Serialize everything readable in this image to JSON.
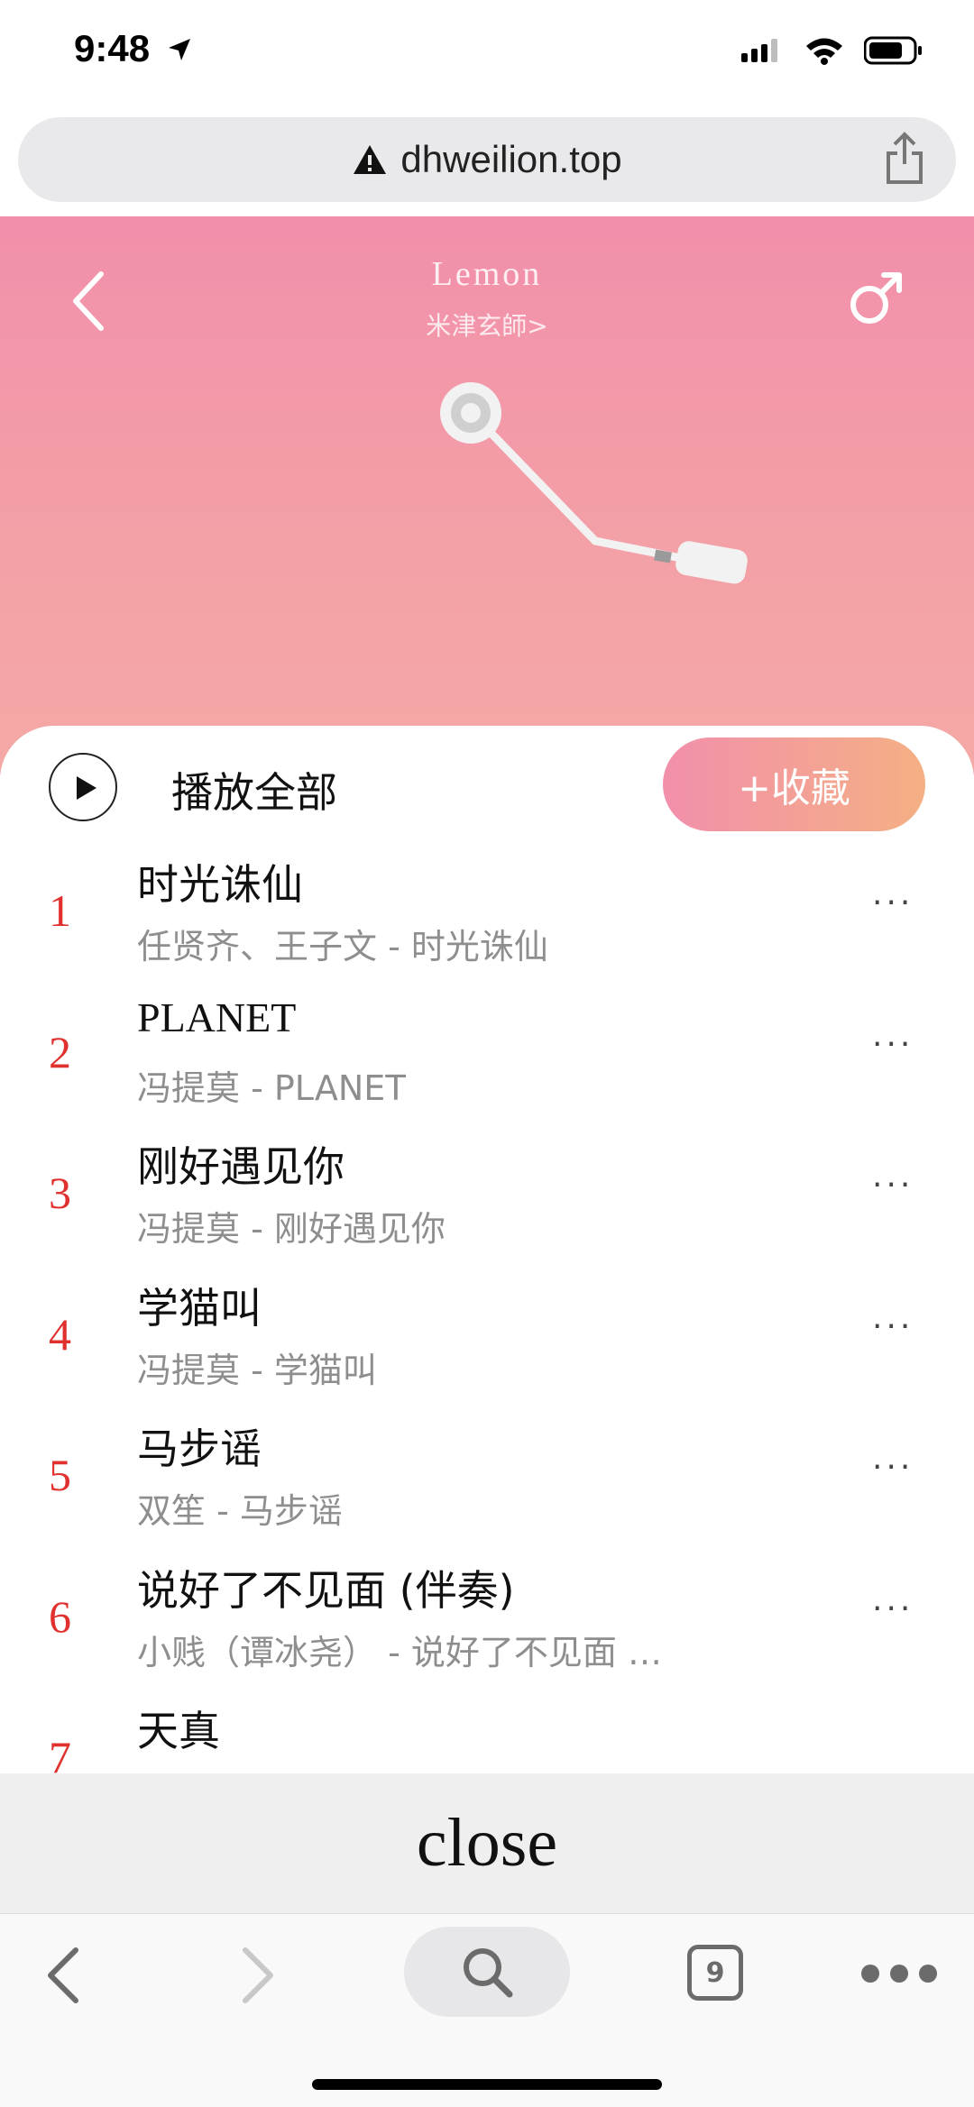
{
  "status_bar": {
    "time": "9:48"
  },
  "browser": {
    "url": "dhweilion.top",
    "tab_count": "9"
  },
  "player": {
    "title": "Lemon",
    "artist": "米津玄師>"
  },
  "playlist": {
    "play_all_label": "播放全部",
    "collect_label": "+收藏",
    "tracks": [
      {
        "index": "1",
        "title": "时光诛仙",
        "subtitle": "任贤齐、王子文 - 时光诛仙"
      },
      {
        "index": "2",
        "title": "PLANET",
        "subtitle": "冯提莫 - PLANET"
      },
      {
        "index": "3",
        "title": "刚好遇见你",
        "subtitle": "冯提莫 - 刚好遇见你"
      },
      {
        "index": "4",
        "title": "学猫叫",
        "subtitle": "冯提莫 - 学猫叫"
      },
      {
        "index": "5",
        "title": "马步谣",
        "subtitle": "双笙 - 马步谣"
      },
      {
        "index": "6",
        "title": "说好了不见面 (伴奏)",
        "subtitle": "小贱（谭冰尧） - 说好了不见面 …"
      },
      {
        "index": "7",
        "title": "天真",
        "subtitle": ""
      }
    ],
    "more_label": "···"
  },
  "close_bar": {
    "label": "close"
  },
  "colors": {
    "accent_pink": "#f28fab",
    "index_red": "#e0312e"
  }
}
